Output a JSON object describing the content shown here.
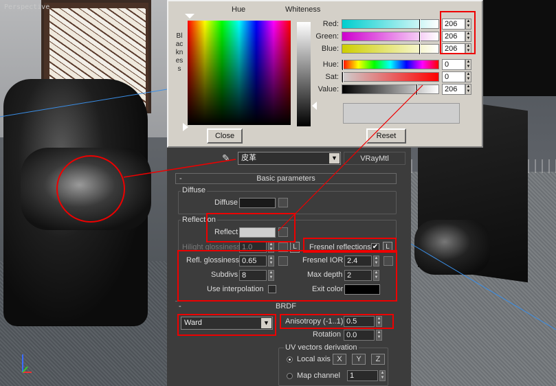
{
  "viewport_label": "Perspective",
  "color_picker": {
    "hue_label": "Hue",
    "whiteness_label": "Whiteness",
    "blackness_label": "Blackness",
    "rows": [
      {
        "label": "Red:",
        "value": "206",
        "gradient": "linear-gradient(90deg,#00cece,#fff)"
      },
      {
        "label": "Green:",
        "value": "206",
        "gradient": "linear-gradient(90deg,#ce00ce,#fff)"
      },
      {
        "label": "Blue:",
        "value": "206",
        "gradient": "linear-gradient(90deg,#cece00,#fff)"
      },
      {
        "label": "Hue:",
        "value": "0",
        "gradient": "linear-gradient(90deg,#f00,#ff0,#0f0,#0ff,#00f,#f0f,#f00)"
      },
      {
        "label": "Sat:",
        "value": "0",
        "gradient": "linear-gradient(90deg,#cecece,#f00)"
      },
      {
        "label": "Value:",
        "value": "206",
        "gradient": "linear-gradient(90deg,#000,#fff)"
      }
    ],
    "preview_color": "#cecece",
    "close_label": "Close",
    "reset_label": "Reset"
  },
  "material": {
    "name": "皮革",
    "type": "VRayMtl"
  },
  "basic": {
    "rollout_title": "Basic parameters",
    "diffuse_group": "Diffuse",
    "diffuse_label": "Diffuse",
    "diffuse_color": "#1a1a1a",
    "reflection_group": "Reflection",
    "reflect_label": "Reflect",
    "reflect_color": "#cecece",
    "hilight_label": "Hilight glossiness",
    "hilight_value": "1.0",
    "hilight_lock": "L",
    "fresnel_label": "Fresnel reflections",
    "fresnel_checked": "✔",
    "fresnel_lock": "L",
    "refl_gloss_label": "Refl. glossiness",
    "refl_gloss_value": "0.65",
    "fresnel_ior_label": "Fresnel IOR",
    "fresnel_ior_value": "2.4",
    "subdivs_label": "Subdivs",
    "subdivs_value": "8",
    "max_depth_label": "Max depth",
    "max_depth_value": "2",
    "use_interp_label": "Use interpolation",
    "exit_color_label": "Exit color",
    "exit_color": "#000000"
  },
  "brdf": {
    "rollout_title": "BRDF",
    "type_value": "Ward",
    "aniso_label": "Anisotropy (-1..1)",
    "aniso_value": "0.5",
    "rotation_label": "Rotation",
    "rotation_value": "0.0",
    "uv_group": "UV vectors derivation",
    "local_axis_label": "Local axis",
    "axis_x": "X",
    "axis_y": "Y",
    "axis_z": "Z",
    "map_channel_label": "Map channel",
    "map_channel_value": "1"
  },
  "colors": {
    "highlight": "#e00000"
  }
}
